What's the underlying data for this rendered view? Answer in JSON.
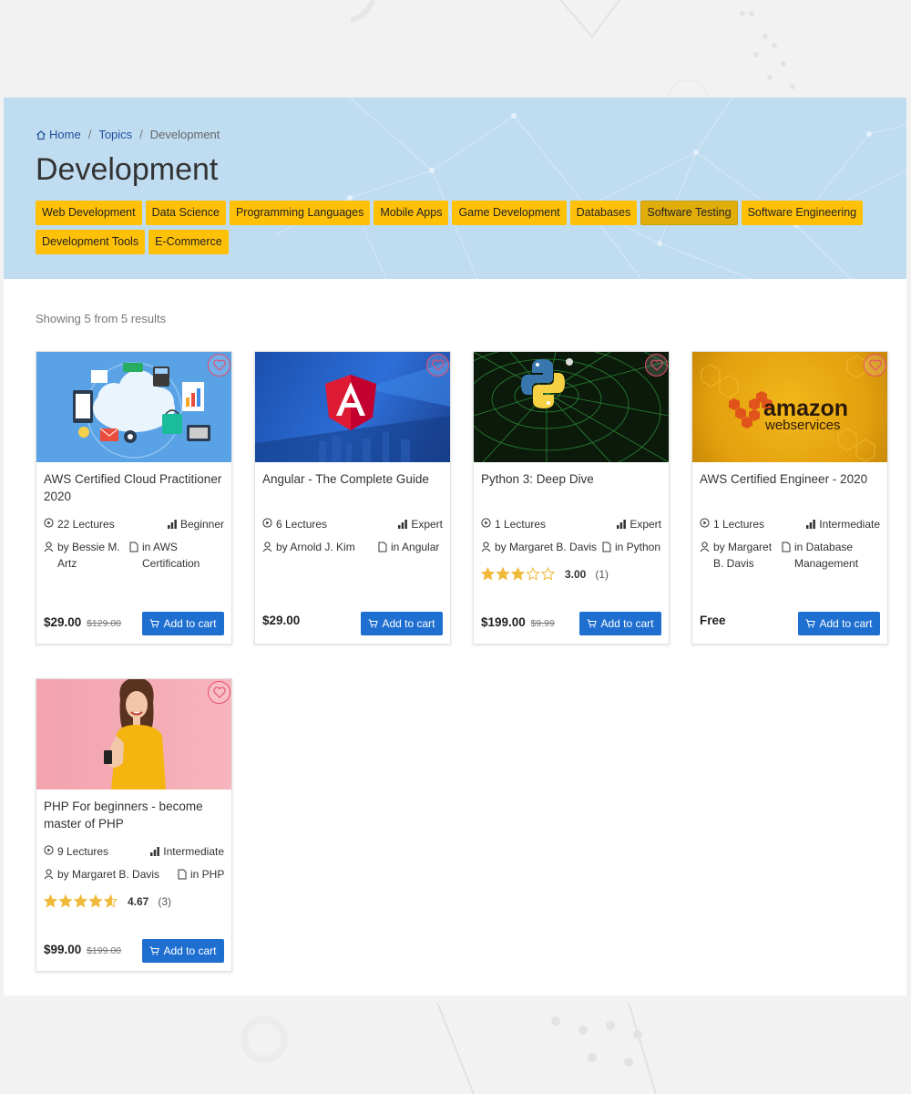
{
  "breadcrumb": {
    "home": "Home",
    "topics": "Topics",
    "current": "Development",
    "separator": "/"
  },
  "page_title": "Development",
  "tags": [
    {
      "label": "Web Development",
      "active": false
    },
    {
      "label": "Data Science",
      "active": false
    },
    {
      "label": "Programming Languages",
      "active": false
    },
    {
      "label": "Mobile Apps",
      "active": false
    },
    {
      "label": "Game Development",
      "active": false
    },
    {
      "label": "Databases",
      "active": false
    },
    {
      "label": "Software Testing",
      "active": true
    },
    {
      "label": "Software Engineering",
      "active": false
    },
    {
      "label": "Development Tools",
      "active": false
    },
    {
      "label": "E-Commerce",
      "active": false
    }
  ],
  "results_text": "Showing 5 from 5 results",
  "cart_label": "Add to cart",
  "courses": [
    {
      "title": "AWS Certified Cloud Practitioner 2020",
      "lectures": "22 Lectures",
      "level": "Beginner",
      "author": "by Bessie M. Artz",
      "topic": "in AWS Certification",
      "price": "$29.00",
      "old_price": "$129.00",
      "thumb_icon": "cloud-devices-illustration"
    },
    {
      "title": "Angular - The Complete Guide",
      "lectures": "6 Lectures",
      "level": "Expert",
      "author": "by Arnold J. Kim",
      "topic": "in Angular",
      "price": "$29.00",
      "old_price": "",
      "thumb_icon": "angular-logo"
    },
    {
      "title": "Python 3: Deep Dive",
      "lectures": "1 Lectures",
      "level": "Expert",
      "author": "by Margaret B. Davis",
      "topic": "in Python",
      "price": "$199.00",
      "old_price": "$9.99",
      "rating": 3.0,
      "rating_text": "3.00",
      "rating_count": "(1)",
      "thumb_icon": "python-logo"
    },
    {
      "title": "AWS Certified Engineer - 2020",
      "lectures": "1 Lectures",
      "level": "Intermediate",
      "author": "by Margaret B. Davis",
      "topic": "in Database Management",
      "price": "Free",
      "old_price": "",
      "thumb_icon": "amazon-web-services-logo",
      "thumb_text_1": "amazon",
      "thumb_text_2": "webservices"
    },
    {
      "title": "PHP For beginners - become master of PHP",
      "lectures": "9 Lectures",
      "level": "Intermediate",
      "author": "by Margaret B. Davis",
      "topic": "in PHP",
      "price": "$99.00",
      "old_price": "$199.00",
      "rating": 4.67,
      "rating_text": "4.67",
      "rating_count": "(3)",
      "thumb_icon": "woman-with-phone-photo"
    }
  ],
  "colors": {
    "hero": "#c0dcf1",
    "tag": "#ffc107",
    "button": "#1f6fd1",
    "heart": "#e74c6b",
    "star": "#f0b93a"
  }
}
